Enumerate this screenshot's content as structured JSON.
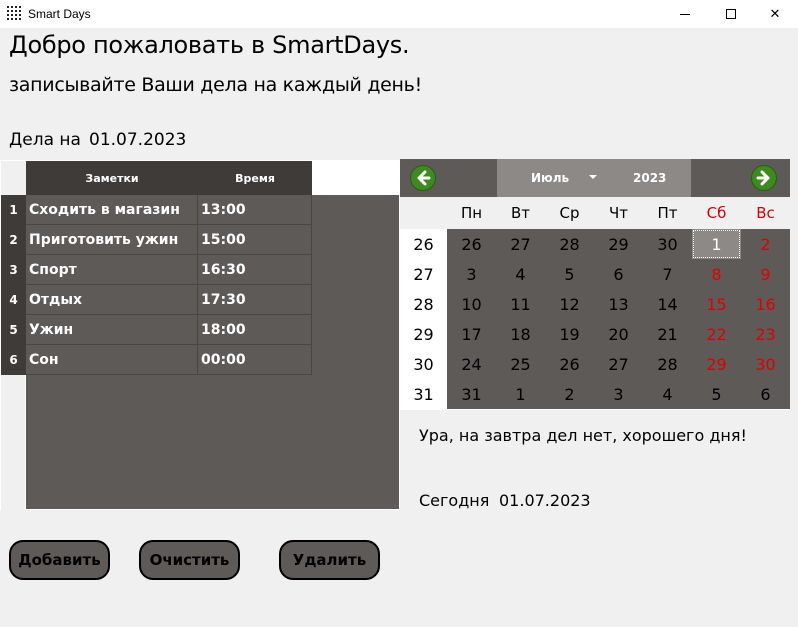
{
  "window": {
    "title": "Smart Days",
    "minimize_icon": "minimize-icon",
    "maximize_icon": "maximize-icon",
    "close_label": "✕"
  },
  "header": {
    "welcome": "Добро пожаловать в SmartDays.",
    "subtitle": "записывайте Ваши дела на каждый день!",
    "tasks_label": "Дела на",
    "tasks_date": "01.07.2023"
  },
  "grid": {
    "columns": [
      "Заметки",
      "Время"
    ],
    "rows": [
      {
        "num": "1",
        "note": "Сходить в магазин",
        "time": "13:00"
      },
      {
        "num": "2",
        "note": "Приготовить ужин",
        "time": "15:00"
      },
      {
        "num": "3",
        "note": "Спорт",
        "time": "16:30"
      },
      {
        "num": "4",
        "note": "Отдых",
        "time": "17:30"
      },
      {
        "num": "5",
        "note": "Ужин",
        "time": "18:00"
      },
      {
        "num": "6",
        "note": "Сон",
        "time": "00:00"
      }
    ]
  },
  "calendar": {
    "month": "Июль",
    "year": "2023",
    "days_of_week": [
      "Пн",
      "Вт",
      "Ср",
      "Чт",
      "Пт",
      "Сб",
      "Вс"
    ],
    "weeks": [
      {
        "num": "26",
        "days": [
          "26",
          "27",
          "28",
          "29",
          "30",
          "1",
          "2"
        ]
      },
      {
        "num": "27",
        "days": [
          "3",
          "4",
          "5",
          "6",
          "7",
          "8",
          "9"
        ]
      },
      {
        "num": "28",
        "days": [
          "10",
          "11",
          "12",
          "13",
          "14",
          "15",
          "16"
        ]
      },
      {
        "num": "29",
        "days": [
          "17",
          "18",
          "19",
          "20",
          "21",
          "22",
          "23"
        ]
      },
      {
        "num": "30",
        "days": [
          "24",
          "25",
          "26",
          "27",
          "28",
          "29",
          "30"
        ]
      },
      {
        "num": "31",
        "days": [
          "31",
          "1",
          "2",
          "3",
          "4",
          "5",
          "6"
        ]
      }
    ],
    "selected_day": "1",
    "weekend_color": "#e00000",
    "nav_color": "#3d8a1e"
  },
  "info": {
    "message": "Ура, на завтра дел нет, хорошего дня!",
    "today_label": "Сегодня",
    "today_date": "01.07.2023"
  },
  "buttons": {
    "add": "Добавить",
    "clear": "Очистить",
    "delete": "Удалить"
  }
}
